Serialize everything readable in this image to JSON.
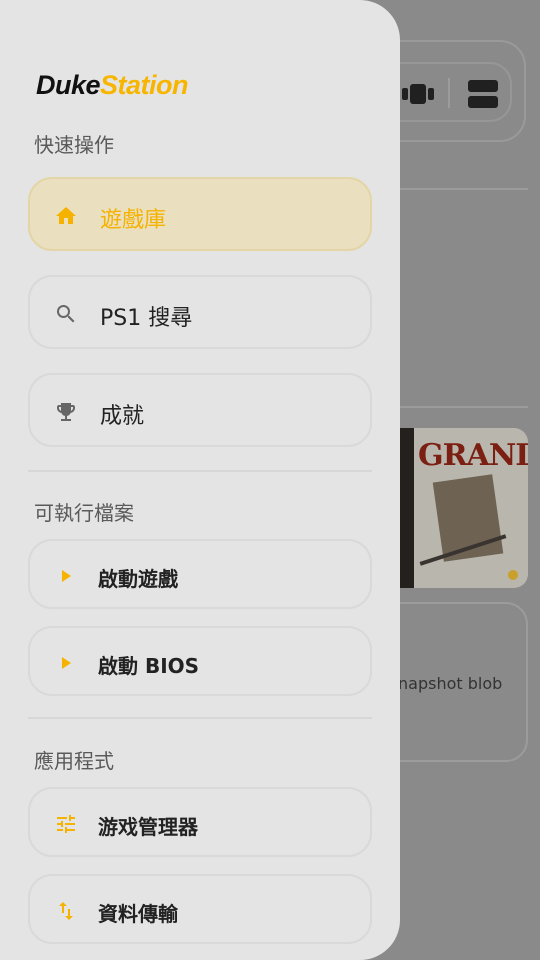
{
  "background": {
    "cover_title": "GRANDIA",
    "card_text": "napshot blob"
  },
  "drawer": {
    "brand": {
      "part1": "Duke",
      "part2": "Station"
    },
    "sections": {
      "quick": "快速操作",
      "executables": "可執行檔案",
      "apps": "應用程式"
    },
    "nav": {
      "library": "遊戲庫",
      "search": "PS1 搜尋",
      "achievements": "成就"
    },
    "exec": {
      "start_game": "啟動遊戲",
      "start_bios": "啟動 BIOS"
    },
    "apps": {
      "game_manager": "游戏管理器",
      "data_transfer": "資料傳輸"
    }
  },
  "colors": {
    "accent": "#F7B500",
    "drawer_bg": "#E4E4E4",
    "active_bg": "#EADFBF"
  },
  "icons": [
    "home-icon",
    "search-icon",
    "trophy-icon",
    "play-icon",
    "tune-icon",
    "swap-vert-icon",
    "carousel-view-icon",
    "list-view-icon"
  ]
}
